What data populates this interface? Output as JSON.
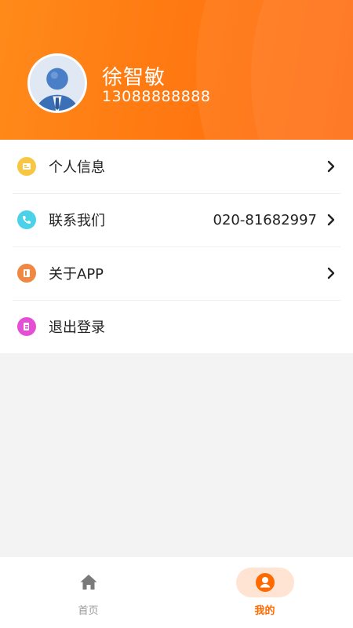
{
  "profile": {
    "name": "徐智敏",
    "phone": "13088888888",
    "avatar_icon": "user-avatar-icon"
  },
  "menu": {
    "items": [
      {
        "label": "个人信息",
        "value": "",
        "icon": "profile-card-icon",
        "icon_color": "#f7c743",
        "has_arrow": true
      },
      {
        "label": "联系我们",
        "value": "020-81682997",
        "icon": "phone-icon",
        "icon_color": "#4cd2e8",
        "has_arrow": true
      },
      {
        "label": "关于APP",
        "value": "",
        "icon": "app-info-icon",
        "icon_color": "#f08742",
        "has_arrow": true
      },
      {
        "label": "退出登录",
        "value": "",
        "icon": "logout-icon",
        "icon_color": "#e44fd6",
        "has_arrow": false
      }
    ]
  },
  "tabbar": {
    "home_label": "首页",
    "mine_label": "我的",
    "active_tab": "mine"
  },
  "colors": {
    "accent": "#ff6a00",
    "header_start": "#ff8a1a",
    "header_end": "#ff6a0e",
    "active_tab_bg": "#ffe4d4",
    "inactive_tab": "#999999"
  }
}
